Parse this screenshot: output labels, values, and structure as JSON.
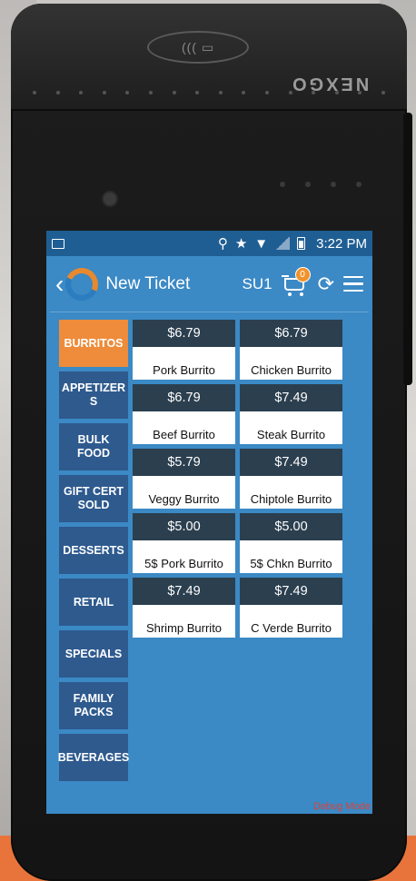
{
  "device": {
    "brand": "NEXGO"
  },
  "statusbar": {
    "time": "3:22 PM"
  },
  "header": {
    "title": "New Ticket",
    "user": "SU1",
    "cart_count": "0"
  },
  "categories": [
    {
      "label": "BURRITOS",
      "active": true
    },
    {
      "label": "APPETIZER S",
      "active": false
    },
    {
      "label": "BULK FOOD",
      "active": false
    },
    {
      "label": "GIFT CERT SOLD",
      "active": false
    },
    {
      "label": "DESSERTS",
      "active": false
    },
    {
      "label": "RETAIL",
      "active": false
    },
    {
      "label": "SPECIALS",
      "active": false
    },
    {
      "label": "FAMILY PACKS",
      "active": false
    },
    {
      "label": "BEVERAGES",
      "active": false
    }
  ],
  "items": [
    {
      "price": "$6.79",
      "name": "Pork Burrito"
    },
    {
      "price": "$6.79",
      "name": "Chicken Burrito"
    },
    {
      "price": "$6.79",
      "name": "Beef Burrito"
    },
    {
      "price": "$7.49",
      "name": "Steak Burrito"
    },
    {
      "price": "$5.79",
      "name": "Veggy Burrito"
    },
    {
      "price": "$7.49",
      "name": "Chiptole Burrito"
    },
    {
      "price": "$5.00",
      "name": "5$ Pork Burrito"
    },
    {
      "price": "$5.00",
      "name": "5$ Chkn Burrito"
    },
    {
      "price": "$7.49",
      "name": "Shrimp Burrito"
    },
    {
      "price": "$7.49",
      "name": "C Verde Burrito"
    }
  ],
  "footer": {
    "debug": "Debug Mode"
  },
  "colors": {
    "accent": "#ee8c3b",
    "screen_bg": "#3b89c5",
    "category_bg": "#2e5a8e",
    "price_bg": "#2b3f4f"
  }
}
